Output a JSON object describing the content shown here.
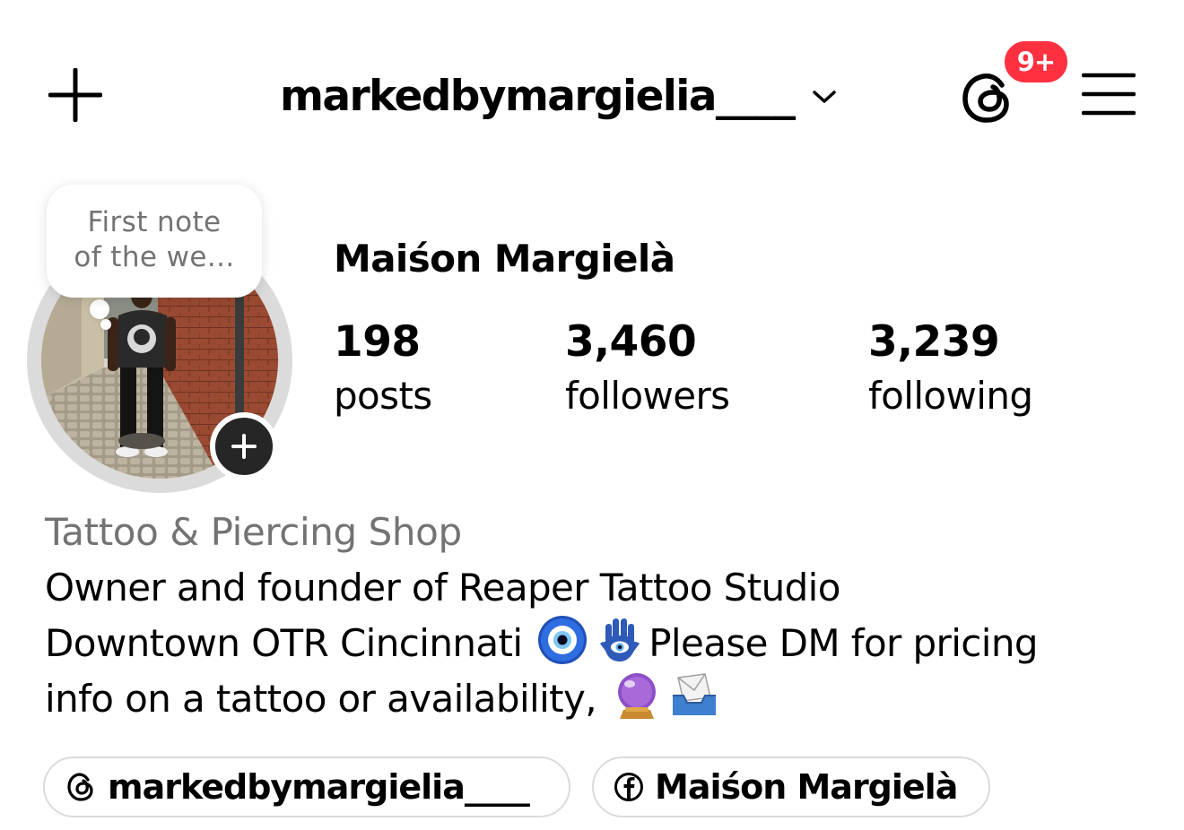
{
  "header": {
    "username": "markedbymargielia____",
    "notification_badge": "9+",
    "icons": [
      "plus-icon",
      "chevron-down-icon",
      "threads-icon",
      "menu-icon"
    ]
  },
  "note": {
    "line1": "First note",
    "line2": "of the we..."
  },
  "profile": {
    "display_name": "Maiśon Margielà",
    "stats": [
      {
        "value": "198",
        "label": "posts"
      },
      {
        "value": "3,460",
        "label": "followers"
      },
      {
        "value": "3,239",
        "label": "following"
      }
    ]
  },
  "bio": {
    "category": "Tattoo & Piercing Shop",
    "line1": "Owner and founder of Reaper Tattoo Studio",
    "line2_a": "Downtown OTR Cincinnati ",
    "line2_b": "Please DM for pricing",
    "line3": "info on a tattoo or availability, ",
    "emojis": [
      "nazar-amulet-emoji",
      "hamsa-emoji",
      "crystal-ball-emoji",
      "envelope-tray-emoji"
    ]
  },
  "links": [
    {
      "icon": "threads-icon",
      "label": "markedbymargielia____"
    },
    {
      "icon": "facebook-icon",
      "label": "Maiśon Margielà"
    }
  ],
  "colors": {
    "badge": "#ff3040",
    "secondary_text": "#737373",
    "border": "#dbdbdb",
    "add_button": "#262626"
  }
}
